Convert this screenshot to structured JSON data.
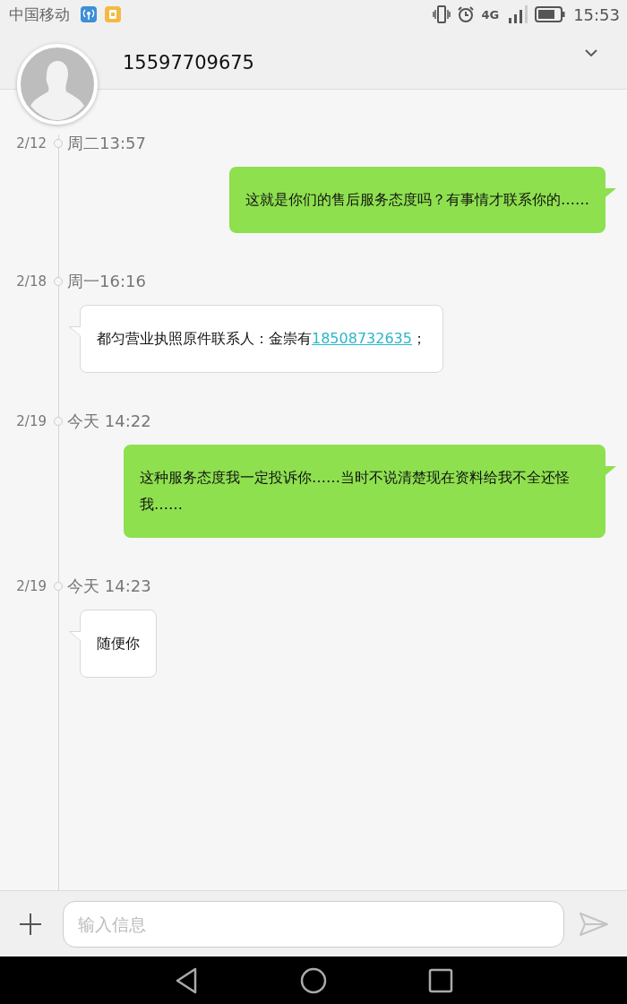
{
  "status_bar": {
    "carrier": "中国移动",
    "time": "15:53",
    "network": "4G"
  },
  "header": {
    "contact": "15597709675"
  },
  "messages": [
    {
      "date": "2/12",
      "time": "周二13:57",
      "kind": "sent",
      "parts": [
        {
          "kind": "text",
          "text": "这就是你们的售后服务态度吗？有事情才联系你的……"
        }
      ]
    },
    {
      "date": "2/18",
      "time": "周一16:16",
      "kind": "received",
      "parts": [
        {
          "kind": "text",
          "text": "都匀营业执照原件联系人：金崇有"
        },
        {
          "kind": "link",
          "text": "18508732635"
        },
        {
          "kind": "text",
          "text": "；"
        }
      ]
    },
    {
      "date": "2/19",
      "time": "今天 14:22",
      "kind": "sent",
      "parts": [
        {
          "kind": "text",
          "text": "这种服务态度我一定投诉你……当时不说清楚现在资料给我不全还怪我……"
        }
      ]
    },
    {
      "date": "2/19",
      "time": "今天 14:23",
      "kind": "received",
      "parts": [
        {
          "kind": "text",
          "text": "随便你"
        }
      ]
    }
  ],
  "composer": {
    "placeholder": "输入信息"
  }
}
